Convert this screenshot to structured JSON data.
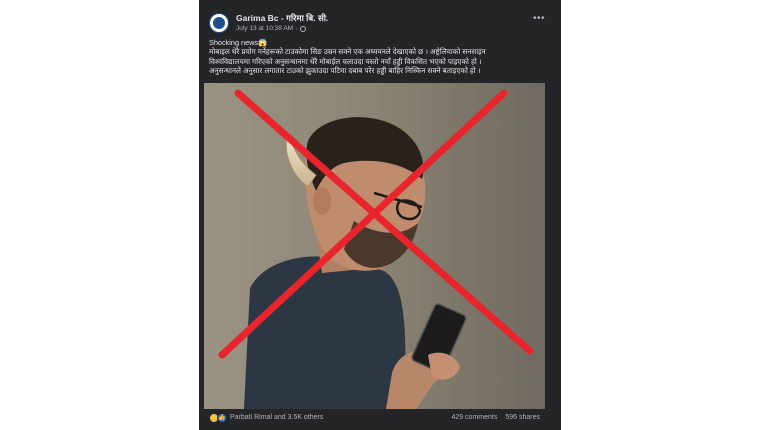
{
  "post": {
    "author": "Garima Bc - गरिमा बि. सी.",
    "timestamp": "July 13 at 10:38 AM",
    "separator": "·",
    "text_lines": [
      "Shocking news😱",
      "मोबाइल धेरै प्रयोग गर्नेहरूको टाउकोमा सिङ उम्रन सक्ने एक अध्ययनले देखाएको छ । अष्ट्रेलियाको सनसाइन",
      "विश्वविद्यालयमा गरिएको अनुसन्धानमा धेरै मोबाईल चलाउदा यस्तो नयाँ हड्डी विकसित भएको पाइएको हो ।",
      "अनुसन्धानले अनुसार लगातार टाउको झुकाउदा पटिमा दबाब परेर हड्डी बाहिर निस्किन सक्ने बताइएको हो ।"
    ],
    "reactions": {
      "summary": "Parbati Rimal and 3.5K others",
      "comments": "429 comments",
      "shares": "596 shares",
      "like_glyph": "👍"
    },
    "more_label": "•••"
  },
  "colors": {
    "card_bg": "#242526",
    "text": "#e4e6eb",
    "muted": "#b0b3b8",
    "cross": "#e8242c",
    "like": "#1b74e4",
    "haha": "#f7c23b"
  }
}
